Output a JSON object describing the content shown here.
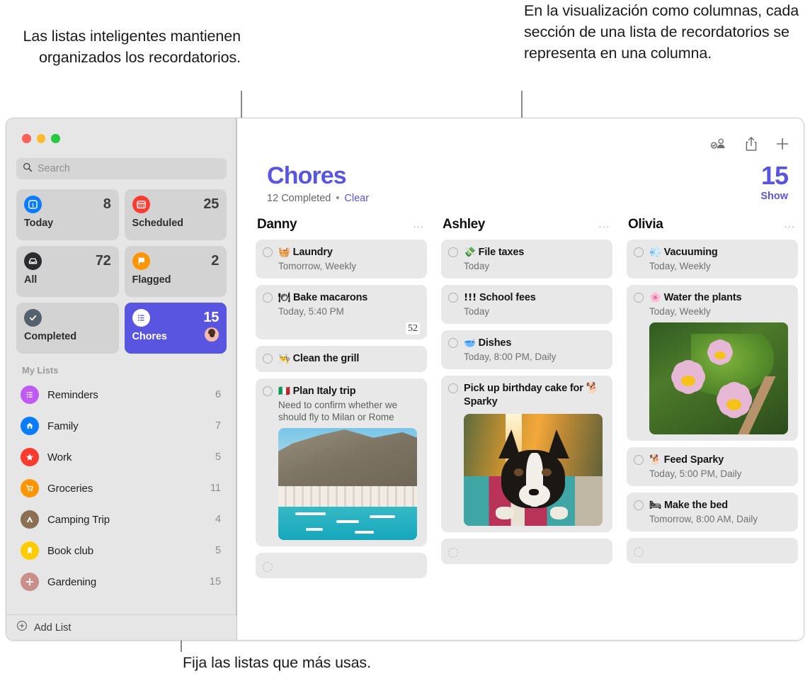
{
  "annotations": {
    "left": "Las listas inteligentes mantienen organizados los recordatorios.",
    "right": "En la visualización como columnas, cada sección de una lista de recordatorios se representa en una columna.",
    "bottom": "Fija las listas que más usas."
  },
  "window": {
    "traffic_lights": [
      "close",
      "minimize",
      "zoom"
    ]
  },
  "sidebar": {
    "search": {
      "placeholder": "Search",
      "value": ""
    },
    "smart_lists": [
      {
        "label": "Today",
        "count": "8",
        "icon": "calendar-day-icon",
        "color": "#0a7cff",
        "selected": false
      },
      {
        "label": "Scheduled",
        "count": "25",
        "icon": "calendar-icon",
        "color": "#ff3b30",
        "selected": false
      },
      {
        "label": "All",
        "count": "72",
        "icon": "inbox-icon",
        "color": "#2c2c2e",
        "selected": false
      },
      {
        "label": "Flagged",
        "count": "2",
        "icon": "flag-icon",
        "color": "#ff9500",
        "selected": false
      },
      {
        "label": "Completed",
        "count": "",
        "icon": "checkmark-icon",
        "color": "#55616d",
        "selected": false
      },
      {
        "label": "Chores",
        "count": "15",
        "icon": "list-bullet-icon",
        "color": "#ffffff",
        "selected": true,
        "shared_avatar": true
      }
    ],
    "my_lists_header": "My Lists",
    "my_lists": [
      {
        "name": "Reminders",
        "count": "6",
        "icon": "list-bullet-icon",
        "color": "#bf5af2"
      },
      {
        "name": "Family",
        "count": "7",
        "icon": "house-icon",
        "color": "#0a7cff"
      },
      {
        "name": "Work",
        "count": "5",
        "icon": "star-icon",
        "color": "#ff3b30"
      },
      {
        "name": "Groceries",
        "count": "11",
        "icon": "cart-icon",
        "color": "#ff9500"
      },
      {
        "name": "Camping Trip",
        "count": "4",
        "icon": "tent-icon",
        "color": "#8a6f52"
      },
      {
        "name": "Book club",
        "count": "5",
        "icon": "bookmark-icon",
        "color": "#ffcc00"
      },
      {
        "name": "Gardening",
        "count": "15",
        "icon": "flower-icon",
        "color": "#c98f8a"
      }
    ],
    "add_list_label": "Add List"
  },
  "main": {
    "toolbar": [
      {
        "name": "shared-person-icon"
      },
      {
        "name": "share-icon"
      },
      {
        "name": "add-icon"
      }
    ],
    "title": "Chores",
    "completed_text": "12 Completed",
    "separator": "•",
    "clear_label": "Clear",
    "total_count": "15",
    "show_label": "Show",
    "accent_color": "#5a55e0",
    "columns": [
      {
        "header": "Danny",
        "more": "...",
        "tasks": [
          {
            "emoji": "🧺",
            "title": "Laundry",
            "subtitle": "Tomorrow, Weekly"
          },
          {
            "emoji": "🍽",
            "title": "Bake macarons",
            "subtitle": "Today, 5:40 PM",
            "badge": "52"
          },
          {
            "emoji": "👨‍🍳",
            "title": "Clean the grill",
            "subtitle": ""
          },
          {
            "emoji": "🇮🇹",
            "title": "Plan Italy trip",
            "note": "Need to confirm whether we should fly to Milan or Rome",
            "photo": "italy-coast-photo"
          },
          {
            "title": "",
            "subtitle": "",
            "empty": true
          }
        ]
      },
      {
        "header": "Ashley",
        "more": "...",
        "tasks": [
          {
            "emoji": "💸",
            "title": "File taxes",
            "subtitle": "Today"
          },
          {
            "emoji": "!!!",
            "title": "School fees",
            "subtitle": "Today"
          },
          {
            "emoji": "🥣",
            "title": "Dishes",
            "subtitle": "Today, 8:00 PM, Daily"
          },
          {
            "title": "Pick up birthday cake for 🐕 Sparky",
            "photo": "dog-photo"
          },
          {
            "title": "",
            "subtitle": "",
            "empty": true
          }
        ]
      },
      {
        "header": "Olivia",
        "more": "...",
        "tasks": [
          {
            "emoji": "💨",
            "title": "Vacuuming",
            "subtitle": "Today, Weekly"
          },
          {
            "emoji": "🌸",
            "title": "Water the plants",
            "subtitle": "Today, Weekly",
            "photo": "flowers-photo"
          },
          {
            "emoji": "🐕",
            "title": "Feed Sparky",
            "subtitle": "Today, 5:00 PM, Daily"
          },
          {
            "emoji": "🛏",
            "title": "Make the bed",
            "subtitle": "Tomorrow, 8:00 AM, Daily"
          },
          {
            "title": "",
            "subtitle": "",
            "empty": true
          }
        ]
      }
    ]
  }
}
